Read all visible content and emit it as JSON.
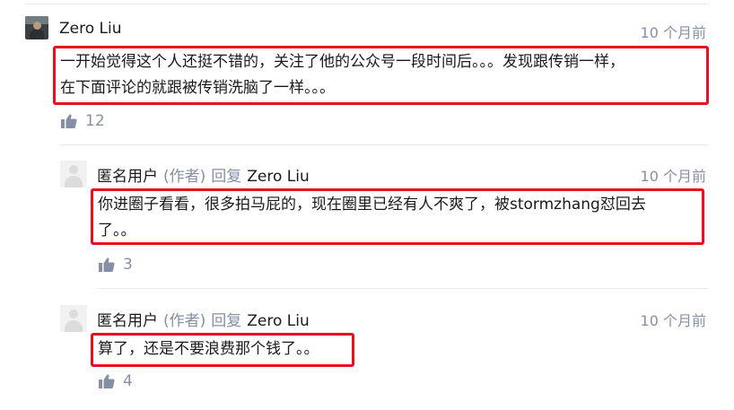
{
  "comments": [
    {
      "author": "Zero Liu",
      "time": "10 个月前",
      "lines": [
        "一开始觉得这个人还挺不错的，关注了他的公众号一段时间后。。。发现跟传销一样，",
        "在下面评论的就跟被传销洗脑了一样。。。"
      ],
      "likes": "12"
    }
  ],
  "replies": [
    {
      "author": "匿名用户",
      "author_tag": "(作者)",
      "reply_word": "回复",
      "reply_to": "Zero Liu",
      "time": "10 个月前",
      "lines": [
        "你进圈子看看，很多拍马屁的，现在圈里已经有人不爽了，被stormzhang怼回去",
        "了。。"
      ],
      "likes": "3"
    },
    {
      "author": "匿名用户",
      "author_tag": "(作者)",
      "reply_word": "回复",
      "reply_to": "Zero Liu",
      "time": "10 个月前",
      "lines": [
        "算了，还是不要浪费那个钱了。。"
      ],
      "likes": "4"
    }
  ],
  "highlight_color": "#e8101e",
  "muted_color": "#8590a6"
}
